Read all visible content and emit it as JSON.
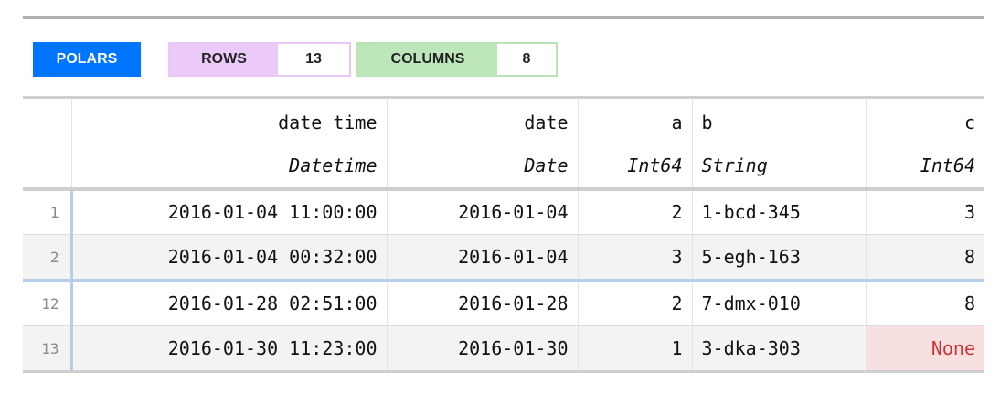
{
  "header": {
    "library": "POLARS",
    "rows_label": "ROWS",
    "rows_value": "13",
    "columns_label": "COLUMNS",
    "columns_value": "8"
  },
  "columns": [
    {
      "name": "date_time",
      "dtype": "Datetime"
    },
    {
      "name": "date",
      "dtype": "Date"
    },
    {
      "name": "a",
      "dtype": "Int64"
    },
    {
      "name": "b",
      "dtype": "String"
    },
    {
      "name": "c",
      "dtype": "Int64"
    }
  ],
  "rows": [
    {
      "index": "1",
      "cells": [
        "2016-01-04 11:00:00",
        "2016-01-04",
        "2",
        "1-bcd-345",
        "3"
      ]
    },
    {
      "index": "2",
      "cells": [
        "2016-01-04 00:32:00",
        "2016-01-04",
        "3",
        "5-egh-163",
        "8"
      ]
    },
    {
      "index": "12",
      "cells": [
        "2016-01-28 02:51:00",
        "2016-01-28",
        "2",
        "7-dmx-010",
        "8"
      ]
    },
    {
      "index": "13",
      "cells": [
        "2016-01-30 11:23:00",
        "2016-01-30",
        "1",
        "3-dka-303",
        "None"
      ]
    }
  ],
  "colors": {
    "polars_badge": "#0075ff",
    "rows_badge": "#ebcaf9",
    "columns_badge": "#bde6bb",
    "null_cell": "#f8e0e0",
    "null_text": "#cc3333"
  }
}
